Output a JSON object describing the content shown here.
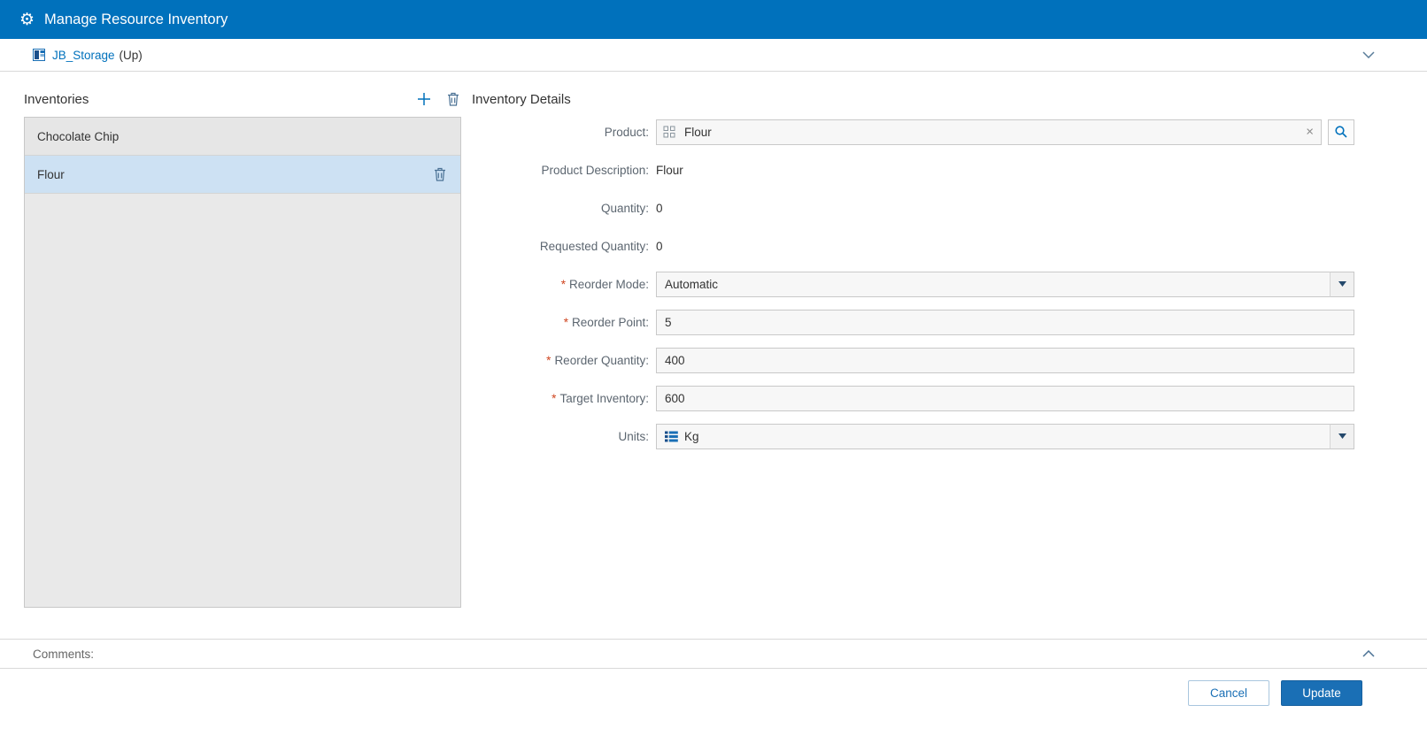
{
  "colors": {
    "accent": "#0071bc",
    "titlebar_bg": "#0071bc",
    "selected_row_bg": "#cde1f3",
    "required_marker_color": "#cf4520",
    "update_button_bg": "#1a6fb5"
  },
  "titlebar": {
    "title": "Manage Resource Inventory"
  },
  "breadcrumb": {
    "location": "JB_Storage",
    "suffix": "(Up)"
  },
  "inventories": {
    "title": "Inventories",
    "items": [
      {
        "label": "Chocolate Chip"
      },
      {
        "label": "Flour"
      }
    ],
    "selected_index": 1
  },
  "details": {
    "title": "Inventory Details",
    "required_marker": "*",
    "fields": {
      "product": {
        "label": "Product:",
        "value": "Flour"
      },
      "product_description": {
        "label": "Product Description:",
        "value": "Flour"
      },
      "quantity": {
        "label": "Quantity:",
        "value": "0"
      },
      "requested_quantity": {
        "label": "Requested Quantity:",
        "value": "0"
      },
      "reorder_mode": {
        "label": "Reorder Mode:",
        "value": "Automatic"
      },
      "reorder_point": {
        "label": "Reorder Point:",
        "value": "5"
      },
      "reorder_quantity": {
        "label": "Reorder Quantity:",
        "value": "400"
      },
      "target_inventory": {
        "label": "Target Inventory:",
        "value": "600"
      },
      "units": {
        "label": "Units:",
        "value": "Kg"
      }
    }
  },
  "comments": {
    "label": "Comments:"
  },
  "footer": {
    "cancel": "Cancel",
    "update": "Update"
  },
  "icons": {
    "gear": "⚙",
    "clear": "×"
  }
}
